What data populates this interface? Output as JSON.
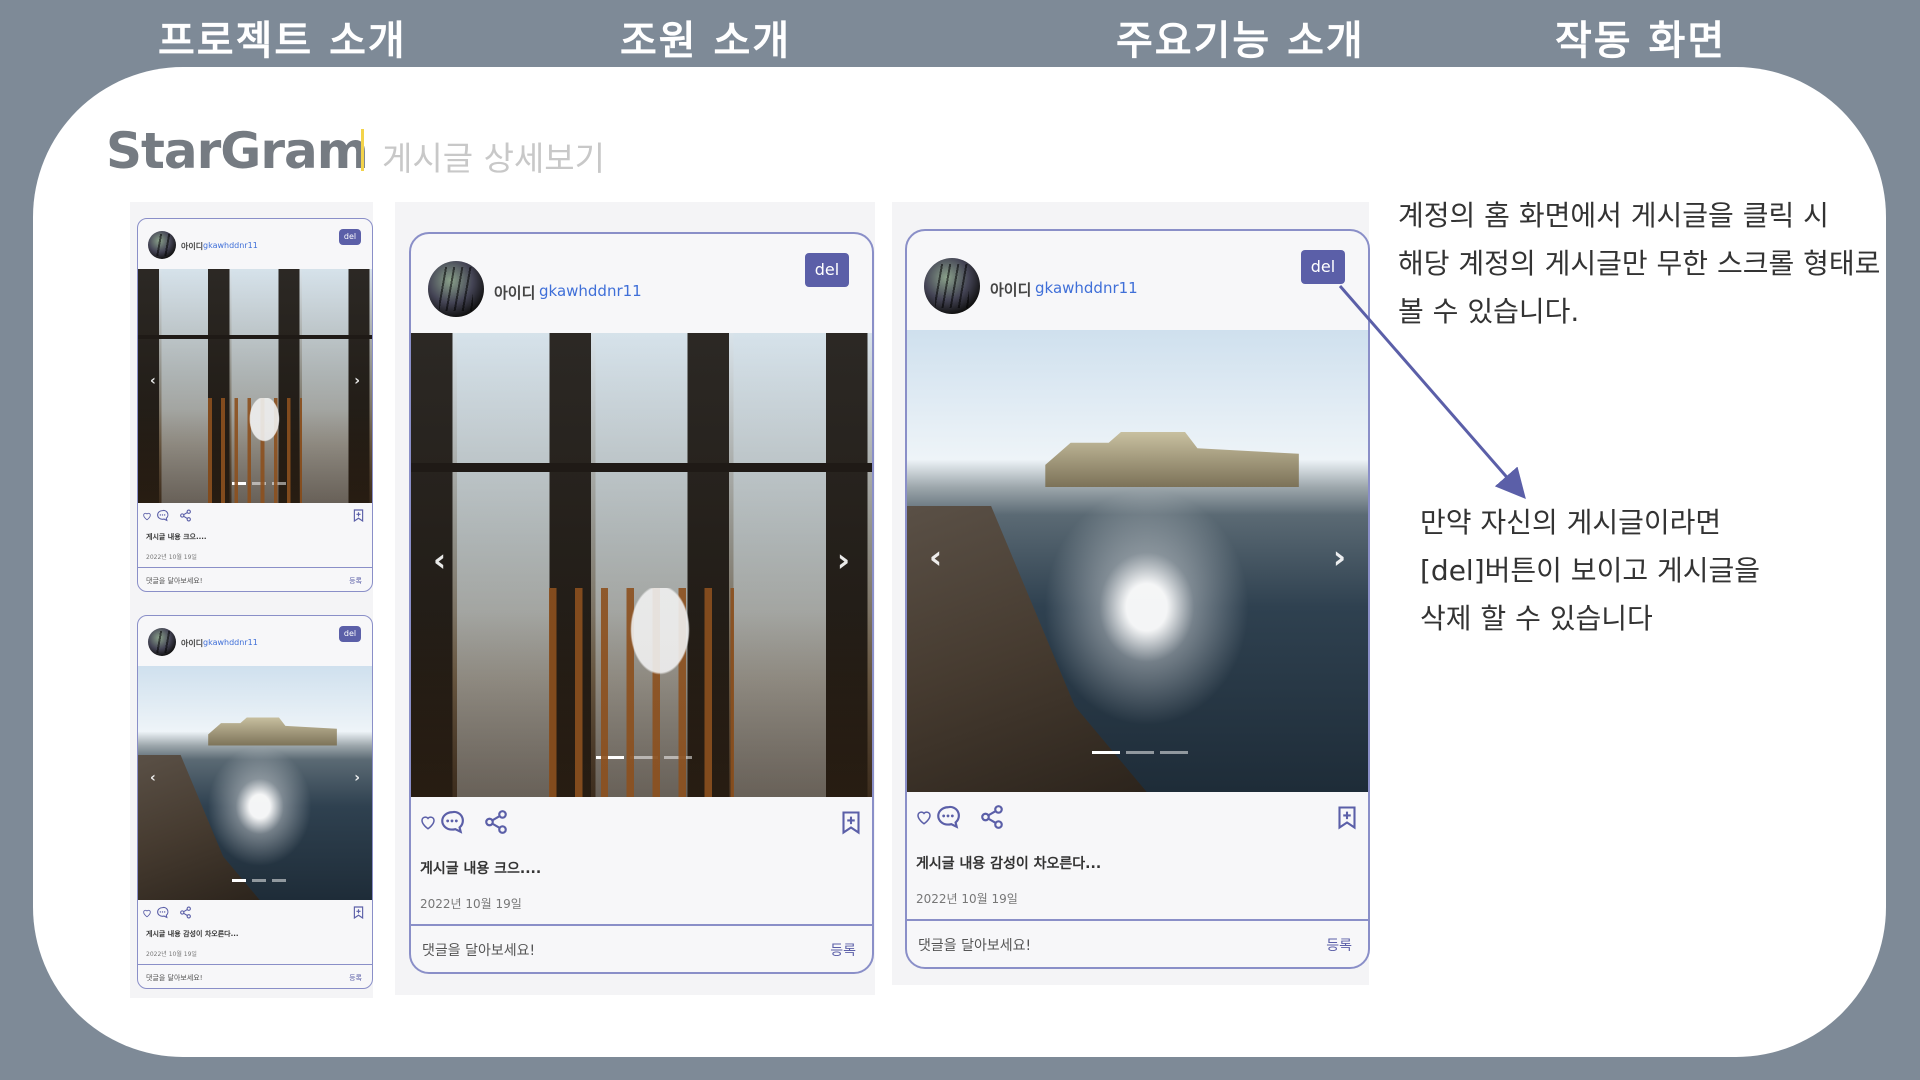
{
  "nav": {
    "items": [
      {
        "label": "프로젝트 소개"
      },
      {
        "label": "조원 소개"
      },
      {
        "label": "주요기능 소개"
      },
      {
        "label": "작동 화면"
      }
    ]
  },
  "brand": {
    "name": "StarGram",
    "subtitle": "게시글 상세보기"
  },
  "posts": [
    {
      "id_label": "아이디",
      "username": "gkawhddnr11",
      "del_label": "del",
      "content": "게시글 내용 크으....",
      "date": "2022년 10월 19일",
      "comment_placeholder": "댓글을 달아보세요!",
      "register_label": "등록",
      "photo_icon": "cafe-photo",
      "slide_dots": 3,
      "active_slide": 1
    },
    {
      "id_label": "아이디",
      "username": "gkawhddnr11",
      "del_label": "del",
      "content": "게시글 내용 감성이 차오른다...",
      "date": "2022년 10월 19일",
      "comment_placeholder": "댓글을 달아보세요!",
      "register_label": "등록",
      "photo_icon": "sea-photo",
      "slide_dots": 3,
      "active_slide": 1
    }
  ],
  "icons": {
    "like": "heart-icon",
    "comment": "comment-icon",
    "share": "share-icon",
    "bookmark": "bookmark-icon",
    "prev": "chevron-left-icon",
    "next": "chevron-right-icon"
  },
  "annotations": {
    "feature_lines": [
      "계정의 홈 화면에서 게시글을 클릭 시",
      "해당 계정의 게시글만 무한 스크롤 형태로",
      "볼 수 있습니다."
    ],
    "del_lines": [
      "만약 자신의 게시글이라면",
      "[del]버튼이 보이고 게시글을",
      "삭제 할 수 있습니다"
    ]
  },
  "colors": {
    "background": "#7e8a97",
    "panel": "#ffffff",
    "accent": "#5b5fa8",
    "card_border": "#8a8fc8",
    "username": "#3f6fd8",
    "brand_divider": "#f3d34a"
  }
}
